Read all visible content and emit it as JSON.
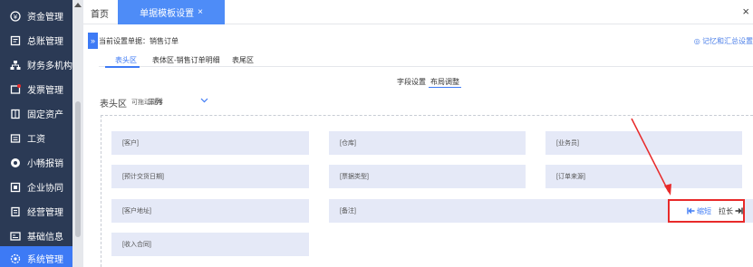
{
  "sidebar": {
    "items": [
      {
        "label": "资金管理",
        "icon": "funds-icon"
      },
      {
        "label": "总账管理",
        "icon": "ledger-icon"
      },
      {
        "label": "财务多机构",
        "icon": "org-icon"
      },
      {
        "label": "发票管理",
        "icon": "invoice-icon"
      },
      {
        "label": "固定资产",
        "icon": "asset-icon"
      },
      {
        "label": "工资",
        "icon": "salary-icon"
      },
      {
        "label": "小畅报销",
        "icon": "reimburse-icon"
      },
      {
        "label": "企业协同",
        "icon": "collab-icon"
      },
      {
        "label": "经营管理",
        "icon": "operation-icon"
      },
      {
        "label": "基础信息",
        "icon": "basic-info-icon"
      },
      {
        "label": "系统管理",
        "icon": "settings-icon"
      }
    ],
    "active_index": 10
  },
  "topbar": {
    "home_label": "首页",
    "active_tab_label": "单据模板设置",
    "tab_close": "×",
    "window_close": "×"
  },
  "header": {
    "collapse_glyph": "»",
    "current_doc": "当前设置单据：销售订单",
    "memory_link": "◎ 记忆和汇总设置"
  },
  "section_tabs": [
    "表头区",
    "表体区-销售订单明细",
    "表尾区"
  ],
  "section_active": 0,
  "sub_tabs": [
    "字段设置",
    "布局调整"
  ],
  "sub_active": 1,
  "area": {
    "title": "表头区",
    "drag_label": "可拖动排序",
    "columns_value": "三列"
  },
  "fields": [
    "[客户]",
    "[仓库]",
    "[业务员]",
    "[预计交货日期]",
    "[票据类型]",
    "[订单来源]",
    "[客户地址]",
    "[备注]",
    "[收入合同]"
  ],
  "controls": {
    "shrink_label": "缩短",
    "stretch_label": "拉长"
  },
  "colors": {
    "sidebar_bg": "#2b3a55",
    "accent": "#3d7af5",
    "field_bg": "#e5e9f7",
    "annotation_red": "#e82a2a"
  }
}
